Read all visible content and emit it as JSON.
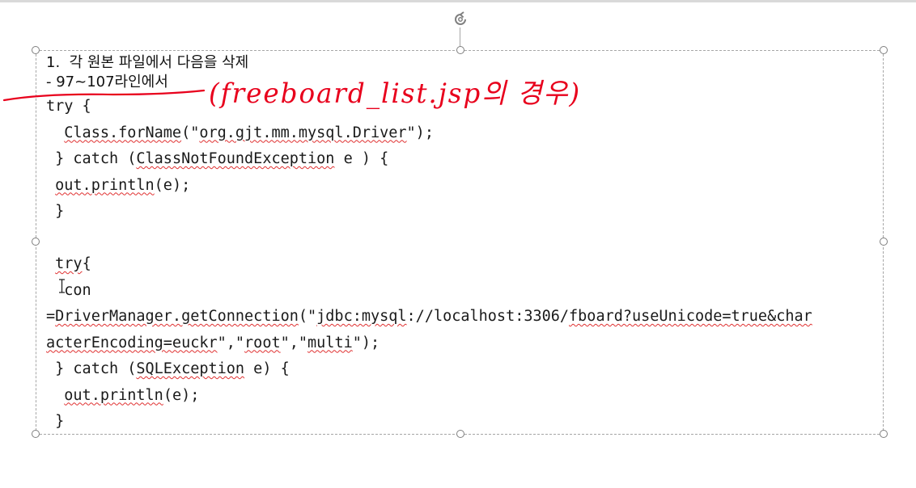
{
  "slide": {
    "heading_line1": "1.  각 원본 파일에서 다음을 삭제",
    "heading_line2": "- 97~107라인에서",
    "annotation": "(freeboard_list.jsp의 경우)",
    "annotation_color": "#e8001c"
  },
  "code": {
    "l1": "try {",
    "l2_a": "  ",
    "l2_b": "Class.forName",
    "l2_c": "(\"",
    "l2_d": "org.gjt.mm.mysql.Driver",
    "l2_e": "\");",
    "l3_a": " } catch (",
    "l3_b": "ClassNotFoundException",
    "l3_c": " e ) {",
    "l4_a": " ",
    "l4_b": "out.println",
    "l4_c": "(e);",
    "l5": " }",
    "l6": "",
    "l7_a": " ",
    "l7_b": "try",
    "l7_c": "{",
    "l8": "  con",
    "l9_a": "=",
    "l9_b": "DriverManager.getConnection",
    "l9_c": "(\"",
    "l9_d": "jdbc:mysql",
    "l9_e": "://localhost:3306/",
    "l9_f": "fboard?useUnicode=true&char",
    "l10_a": "acterEncoding=euckr",
    "l10_b": "\",\"",
    "l10_c": "root",
    "l10_d": "\",\"",
    "l10_e": "multi",
    "l10_f": "\");",
    "l11_a": " } catch (",
    "l11_b": "SQLException",
    "l11_c": " e) {",
    "l12_a": "  ",
    "l12_b": "out.println",
    "l12_c": "(e);",
    "l13": " }"
  }
}
